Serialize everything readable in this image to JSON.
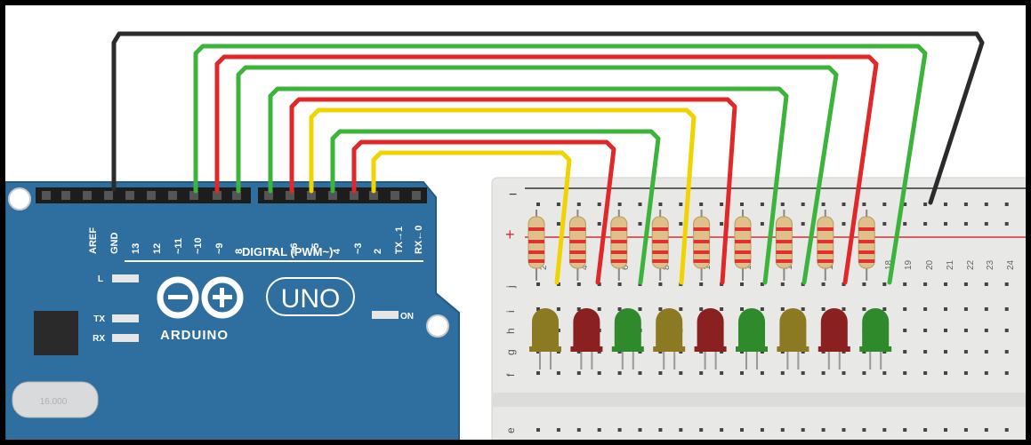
{
  "arduino": {
    "brand": "ARDUINO",
    "model": "UNO",
    "header_title": "DIGITAL (PWM~)",
    "pin_labels": [
      "AREF",
      "GND",
      "13",
      "12",
      "~11",
      "~10",
      "~9",
      "8",
      "7",
      "~6",
      "~5",
      "4",
      "~3",
      "2",
      "TX→1",
      "RX←0"
    ],
    "led_labels": {
      "l": "L",
      "tx": "TX",
      "rx": "RX",
      "on": "ON"
    },
    "crystal_label": "16.000"
  },
  "breadboard": {
    "rail_minus": "−",
    "rail_plus": "+",
    "row_labels": [
      "j",
      "i",
      "h",
      "g",
      "f",
      "e"
    ],
    "column_numbers": [
      "2",
      "4",
      "6",
      "8",
      "10",
      "12",
      "14",
      "16",
      "18",
      "19",
      "20",
      "21",
      "22",
      "23",
      "24"
    ]
  },
  "colors": {
    "board_blue": "#2f6f9f",
    "breadboard": "#e8e8e6",
    "wire_black": "#2b2b2b",
    "wire_green": "#3cb43c",
    "wire_red": "#e02828",
    "wire_yellow": "#f0d400",
    "led_yellow": "#8c7a22",
    "led_red": "#8a2020",
    "led_green": "#2e8a2a",
    "resistor_body": "#e0c08a"
  },
  "circuit": {
    "gnd_wire_color": "black",
    "channels": [
      {
        "pin": "~10",
        "wire_color": "green",
        "led_color": "green"
      },
      {
        "pin": "~9",
        "wire_color": "red",
        "led_color": "red"
      },
      {
        "pin": "8",
        "wire_color": "green",
        "led_color": "yellow"
      },
      {
        "pin": "7",
        "wire_color": "green",
        "led_color": "green"
      },
      {
        "pin": "~6",
        "wire_color": "red",
        "led_color": "red"
      },
      {
        "pin": "~5",
        "wire_color": "yellow",
        "led_color": "yellow"
      },
      {
        "pin": "4",
        "wire_color": "green",
        "led_color": "green"
      },
      {
        "pin": "~3",
        "wire_color": "red",
        "led_color": "red"
      },
      {
        "pin": "2",
        "wire_color": "yellow",
        "led_color": "yellow"
      }
    ]
  }
}
